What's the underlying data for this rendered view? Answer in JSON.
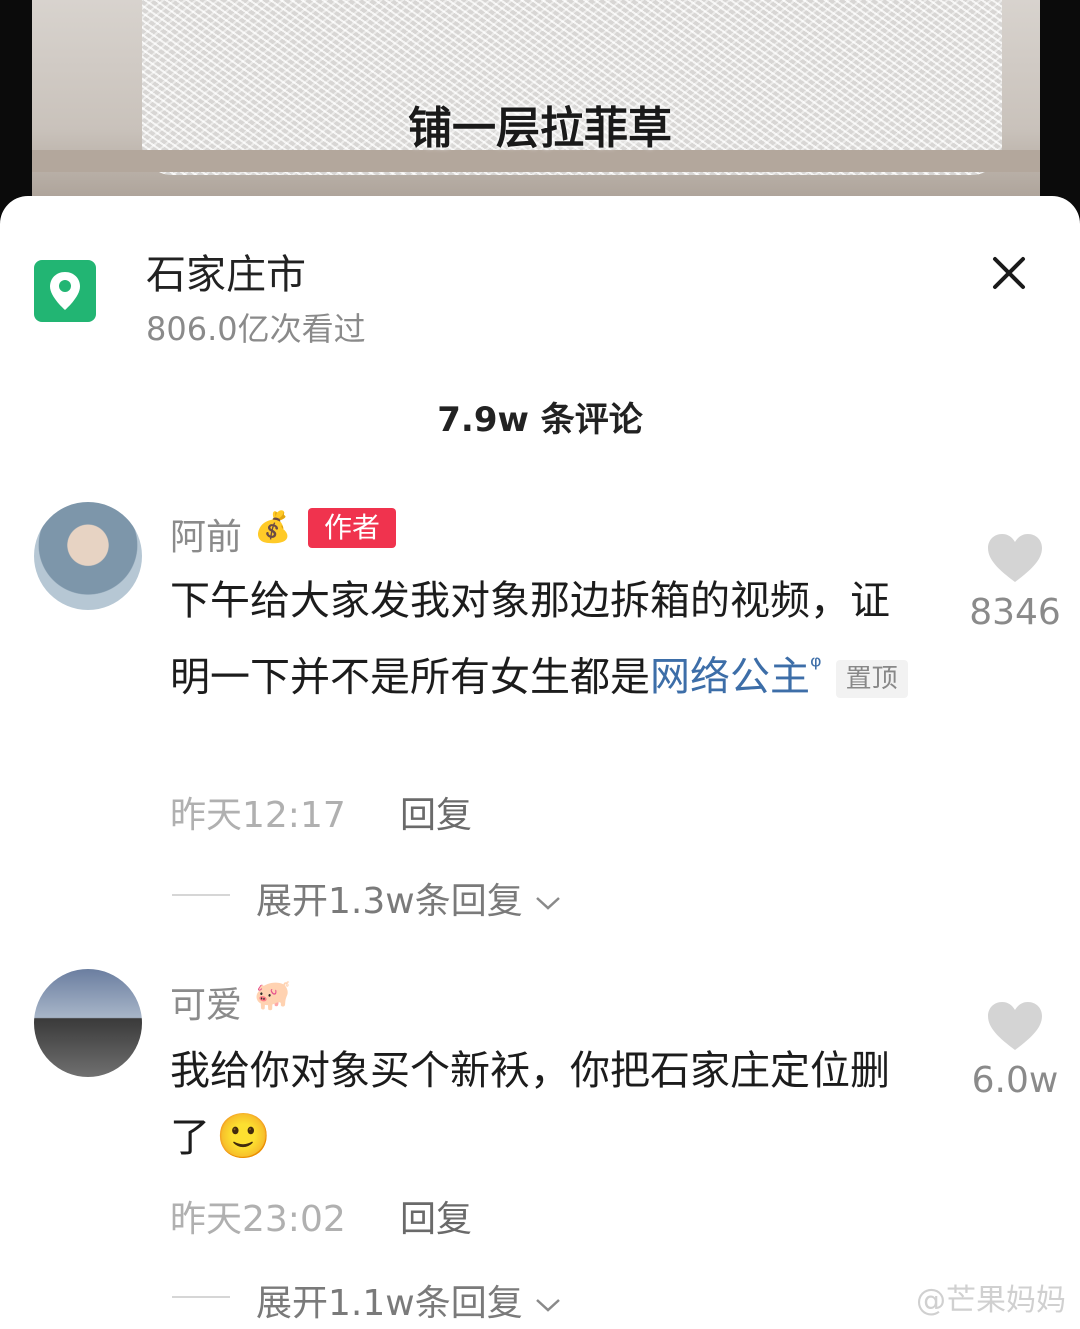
{
  "video": {
    "caption": "铺一层拉菲草"
  },
  "location": {
    "title": "石家庄市",
    "views": "806.0亿次看过"
  },
  "comments_header": {
    "count": "7.9w 条评论"
  },
  "comments": [
    {
      "username": "阿前",
      "name_emoji": "💰",
      "badge": "作者",
      "text_plain": "下午给大家发我对象那边拆箱的视频，证明一下并不是所有女生都是",
      "text_link": "网络公主",
      "link_icon": "ᵠ",
      "pin_label": "置顶",
      "time": "昨天12:17",
      "reply_label": "回复",
      "expand_label": "展开1.3w条回复",
      "likes": "8346"
    },
    {
      "username": "可爱",
      "name_emoji": "🐖",
      "text_plain": "我给你对象买个新袄，你把石家庄定位删了",
      "text_emoji": "🙂",
      "time": "昨天23:02",
      "reply_label": "回复",
      "expand_label": "展开1.1w条回复",
      "likes": "6.0w"
    }
  ],
  "watermark": "@芒果妈妈",
  "colors": {
    "accent_green": "#22b573",
    "badge_red": "#f0334e",
    "link_blue": "#3d6ea8"
  }
}
